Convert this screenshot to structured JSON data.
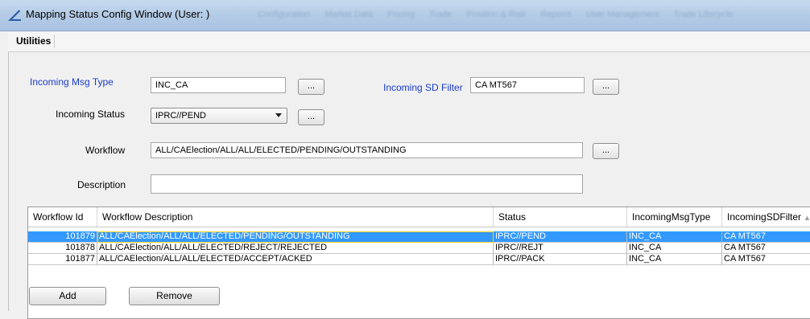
{
  "window": {
    "title": "Mapping Status Config Window (User: )",
    "blurred_menu": [
      "Configuration",
      "Market Data",
      "Pricing",
      "Trade",
      "Position & Risk",
      "Reports",
      "User Management",
      "Trade Lifecycle"
    ]
  },
  "menubar": {
    "utilities": "Utilities"
  },
  "form": {
    "incoming_msg_type_label": "Incoming Msg Type",
    "incoming_msg_type_value": "INC_CA",
    "incoming_sd_filter_label": "Incoming SD Filter",
    "incoming_sd_filter_value": "CA MT567",
    "incoming_status_label": "Incoming Status",
    "incoming_status_value": "IPRC//PEND",
    "workflow_label": "Workflow",
    "workflow_value": "ALL/CAElection/ALL/ALL/ELECTED/PENDING/OUTSTANDING",
    "description_label": "Description",
    "description_value": "",
    "ellipsis": "..."
  },
  "table": {
    "columns": [
      "Workflow Id",
      "Workflow Description",
      "Status",
      "IncomingMsgType",
      "IncomingSDFilter"
    ],
    "rows": [
      {
        "id": "101879",
        "desc": "ALL/CAElection/ALL/ALL/ELECTED/PENDING/OUTSTANDING",
        "status": "IPRC//PEND",
        "msgtype": "INC_CA",
        "sdfilter": "CA MT567"
      },
      {
        "id": "101878",
        "desc": "ALL/CAElection/ALL/ALL/ELECTED/REJECT/REJECTED",
        "status": "IPRC//REJT",
        "msgtype": "INC_CA",
        "sdfilter": "CA MT567"
      },
      {
        "id": "101877",
        "desc": "ALL/CAElection/ALL/ALL/ELECTED/ACCEPT/ACKED",
        "status": "IPRC//PACK",
        "msgtype": "INC_CA",
        "sdfilter": "CA MT567"
      }
    ],
    "selected_row": 0
  },
  "buttons": {
    "add": "Add",
    "remove": "Remove"
  },
  "colors": {
    "label_blue": "#1a3ccc",
    "selection": "#3399ff",
    "focus": "#f2d11d"
  }
}
